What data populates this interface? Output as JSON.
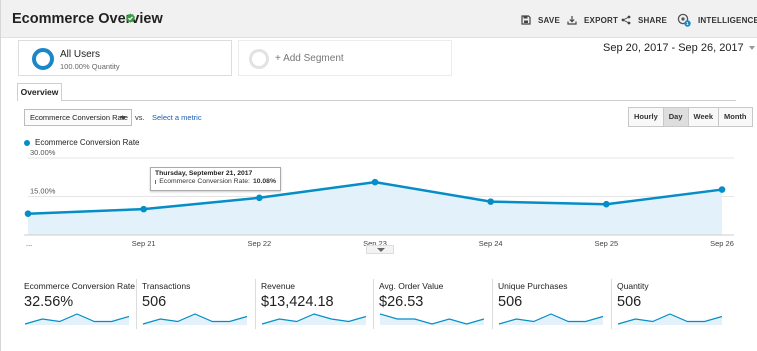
{
  "header": {
    "title": "Ecommerce Overview",
    "save_label": "SAVE",
    "export_label": "EXPORT",
    "share_label": "SHARE",
    "intelligence_label": "INTELLIGENCE",
    "intelligence_badge": "1"
  },
  "segments": {
    "active": {
      "name": "All Users",
      "subtitle": "100.00% Quantity"
    },
    "add_label": "+ Add Segment"
  },
  "date_range": "Sep 20, 2017 - Sep 26, 2017",
  "tabs": {
    "overview": "Overview"
  },
  "controls": {
    "metric_select_value": "Ecommerce Conversion Rate",
    "vs_label": "vs.",
    "select_metric_link": "Select a metric",
    "granularity": [
      {
        "label": "Hourly",
        "active": false
      },
      {
        "label": "Day",
        "active": true
      },
      {
        "label": "Week",
        "active": false
      },
      {
        "label": "Month",
        "active": false
      }
    ]
  },
  "tooltip": {
    "date": "Thursday, September 21, 2017",
    "metric": "Ecommerce Conversion Rate:",
    "value": "10.08%"
  },
  "chart_data": {
    "type": "area",
    "series": [
      {
        "name": "Ecommerce Conversion Rate",
        "values": [
          8.3,
          10.08,
          14.5,
          20.6,
          13.0,
          12.0,
          17.7
        ]
      }
    ],
    "x": [
      "Sep 20",
      "Sep 21",
      "Sep 22",
      "Sep 23",
      "Sep 24",
      "Sep 25",
      "Sep 26"
    ],
    "x_tick_labels": [
      "...",
      "Sep 21",
      "Sep 22",
      "Sep 23",
      "Sep 24",
      "Sep 25",
      "Sep 26"
    ],
    "y_tick_labels": [
      "30.00%",
      "15.00%"
    ],
    "y_ticks": [
      30,
      15
    ],
    "ylim": [
      0,
      30
    ],
    "grid": true,
    "color": "#058dc7",
    "fill_color": "#e3f2fa"
  },
  "scorecards": [
    {
      "label": "Ecommerce Conversion Rate",
      "value": "32.56%",
      "spark": [
        3,
        5,
        4,
        7,
        4,
        4,
        6
      ]
    },
    {
      "label": "Transactions",
      "value": "506",
      "spark": [
        3,
        5,
        4,
        7,
        4,
        4,
        6
      ]
    },
    {
      "label": "Revenue",
      "value": "$13,424.18",
      "spark": [
        3,
        5,
        4,
        7,
        5,
        4,
        6
      ]
    },
    {
      "label": "Avg. Order Value",
      "value": "$26.53",
      "spark": [
        6,
        5,
        5,
        4,
        5,
        4,
        5
      ]
    },
    {
      "label": "Unique Purchases",
      "value": "506",
      "spark": [
        3,
        5,
        4,
        7,
        4,
        4,
        6
      ]
    },
    {
      "label": "Quantity",
      "value": "506",
      "spark": [
        3,
        5,
        4,
        7,
        4,
        4,
        6
      ]
    }
  ],
  "colors": {
    "accent": "#058dc7",
    "ring": "#1b87c9",
    "link": "#1a5fb4",
    "verified": "#3c9a46"
  }
}
